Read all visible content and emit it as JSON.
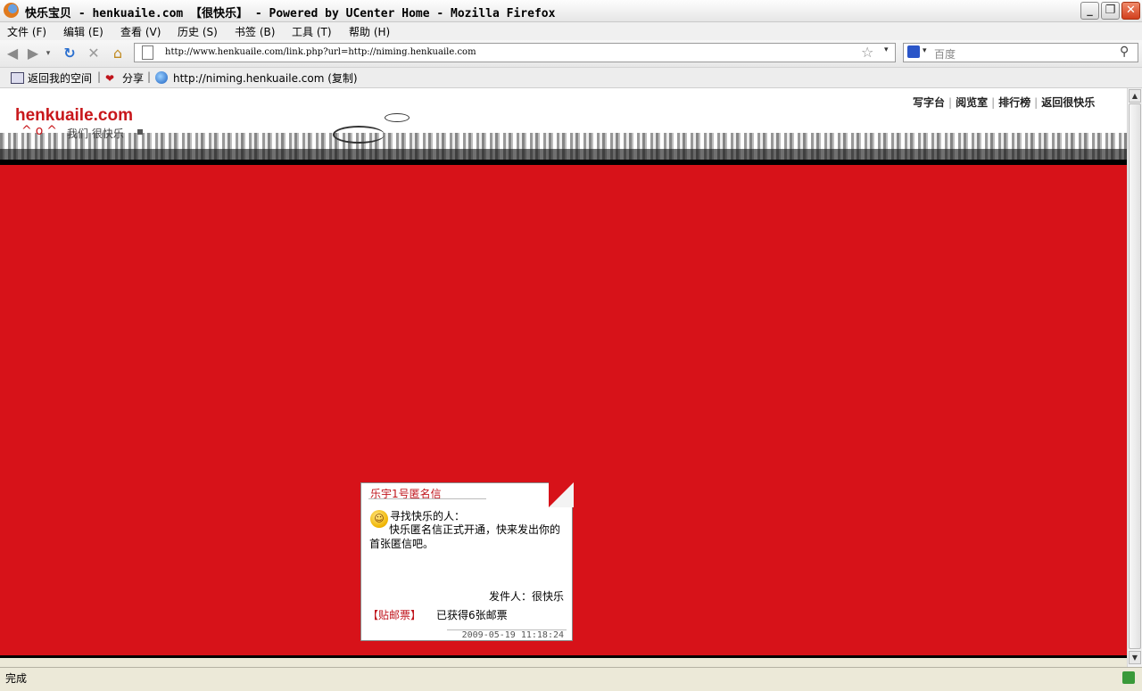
{
  "window": {
    "title": "快乐宝贝 - henkuaile.com 【很快乐】 - Powered by UCenter Home - Mozilla Firefox",
    "minimize": "_",
    "restore": "❐",
    "close": "✕"
  },
  "menubar": {
    "items": [
      {
        "label": "文件 (F)"
      },
      {
        "label": "编辑 (E)"
      },
      {
        "label": "查看 (V)"
      },
      {
        "label": "历史 (S)"
      },
      {
        "label": "书签 (B)"
      },
      {
        "label": "工具 (T)"
      },
      {
        "label": "帮助 (H)"
      }
    ]
  },
  "navbar": {
    "url": "http://www.henkuaile.com/link.php?url=http://niming.henkuaile.com",
    "search_placeholder": "百度"
  },
  "bookmarks": {
    "items": [
      {
        "label": "返回我的空间"
      },
      {
        "label": "分享"
      },
      {
        "label": "http://niming.henkuaile.com (复制)"
      }
    ],
    "separator": "|"
  },
  "site": {
    "logo": "henkuaile.com",
    "logo_face": "^o^",
    "tagline": "我们 很快乐",
    "nav": [
      {
        "label": "写字台"
      },
      {
        "label": "阅览室"
      },
      {
        "label": "排行榜"
      },
      {
        "label": "返回很快乐"
      }
    ],
    "accent_color": "#d71219"
  },
  "card": {
    "title": "乐宇1号匿名信",
    "greeting": "寻找快乐的人：",
    "body": "快乐匿名信正式开通，快来发出你的首张匿信吧。",
    "sender": "发件人：很快乐",
    "stamp_link": "【贴邮票】",
    "stamp_count": "已获得6张邮票",
    "date": "2009-05-19 11:18:24"
  },
  "statusbar": {
    "text": "完成"
  }
}
